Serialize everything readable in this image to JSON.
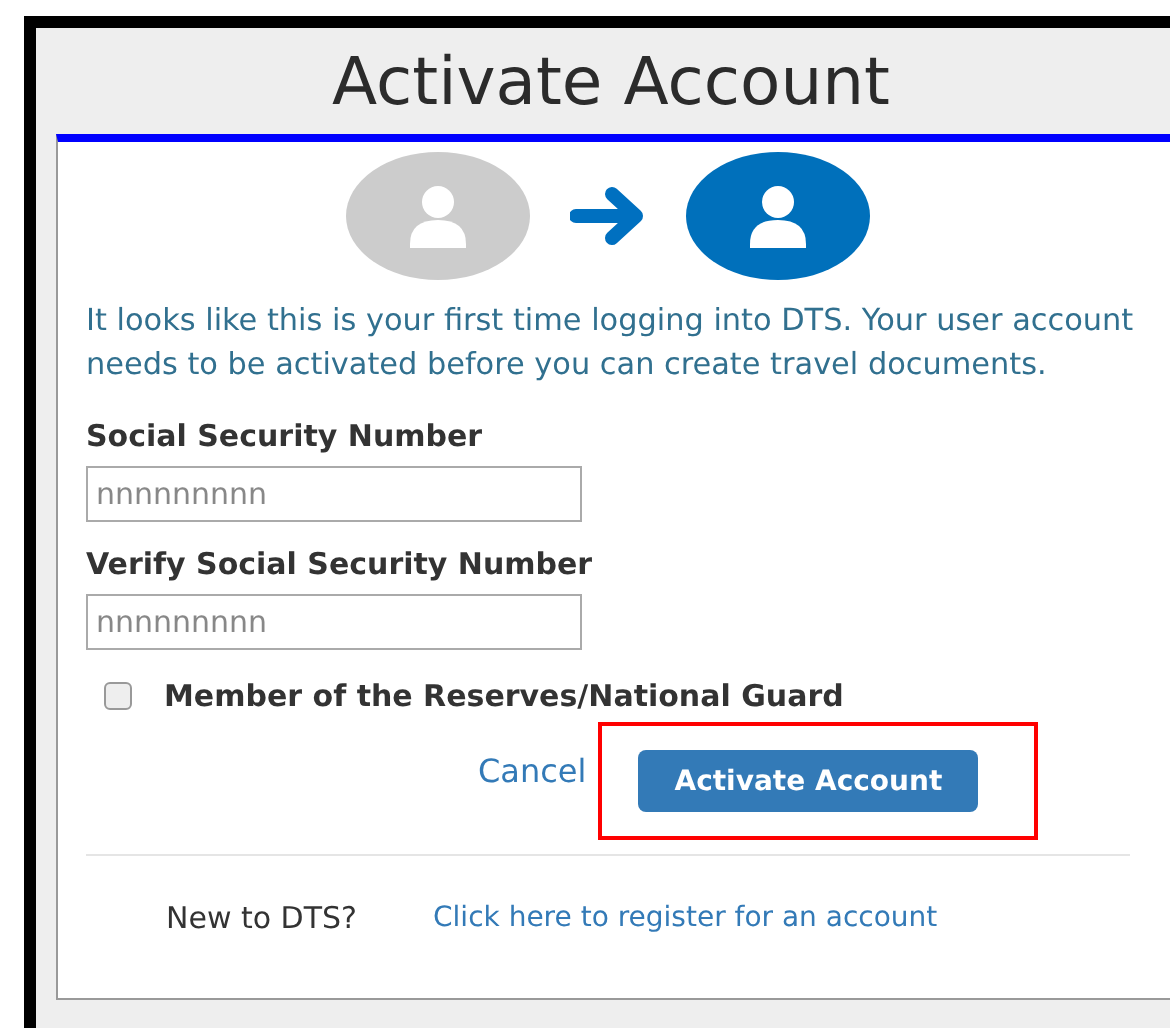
{
  "title": "Activate Account",
  "message": "It looks like this is your first time logging into DTS. Your user account needs to be activated before you can create travel documents.",
  "fields": [
    {
      "label": "Social Security Number",
      "placeholder": "nnnnnnnnn"
    },
    {
      "label": "Verify Social Security Number",
      "placeholder": "nnnnnnnnn"
    }
  ],
  "checkbox": {
    "label": "Member of the Reserves/National Guard",
    "checked": false
  },
  "cancel": "Cancel",
  "submit": {
    "label": "Activate Account",
    "highlighted": true
  },
  "footer": {
    "prompt": "New to DTS?",
    "link": "Click here to register for an account"
  }
}
